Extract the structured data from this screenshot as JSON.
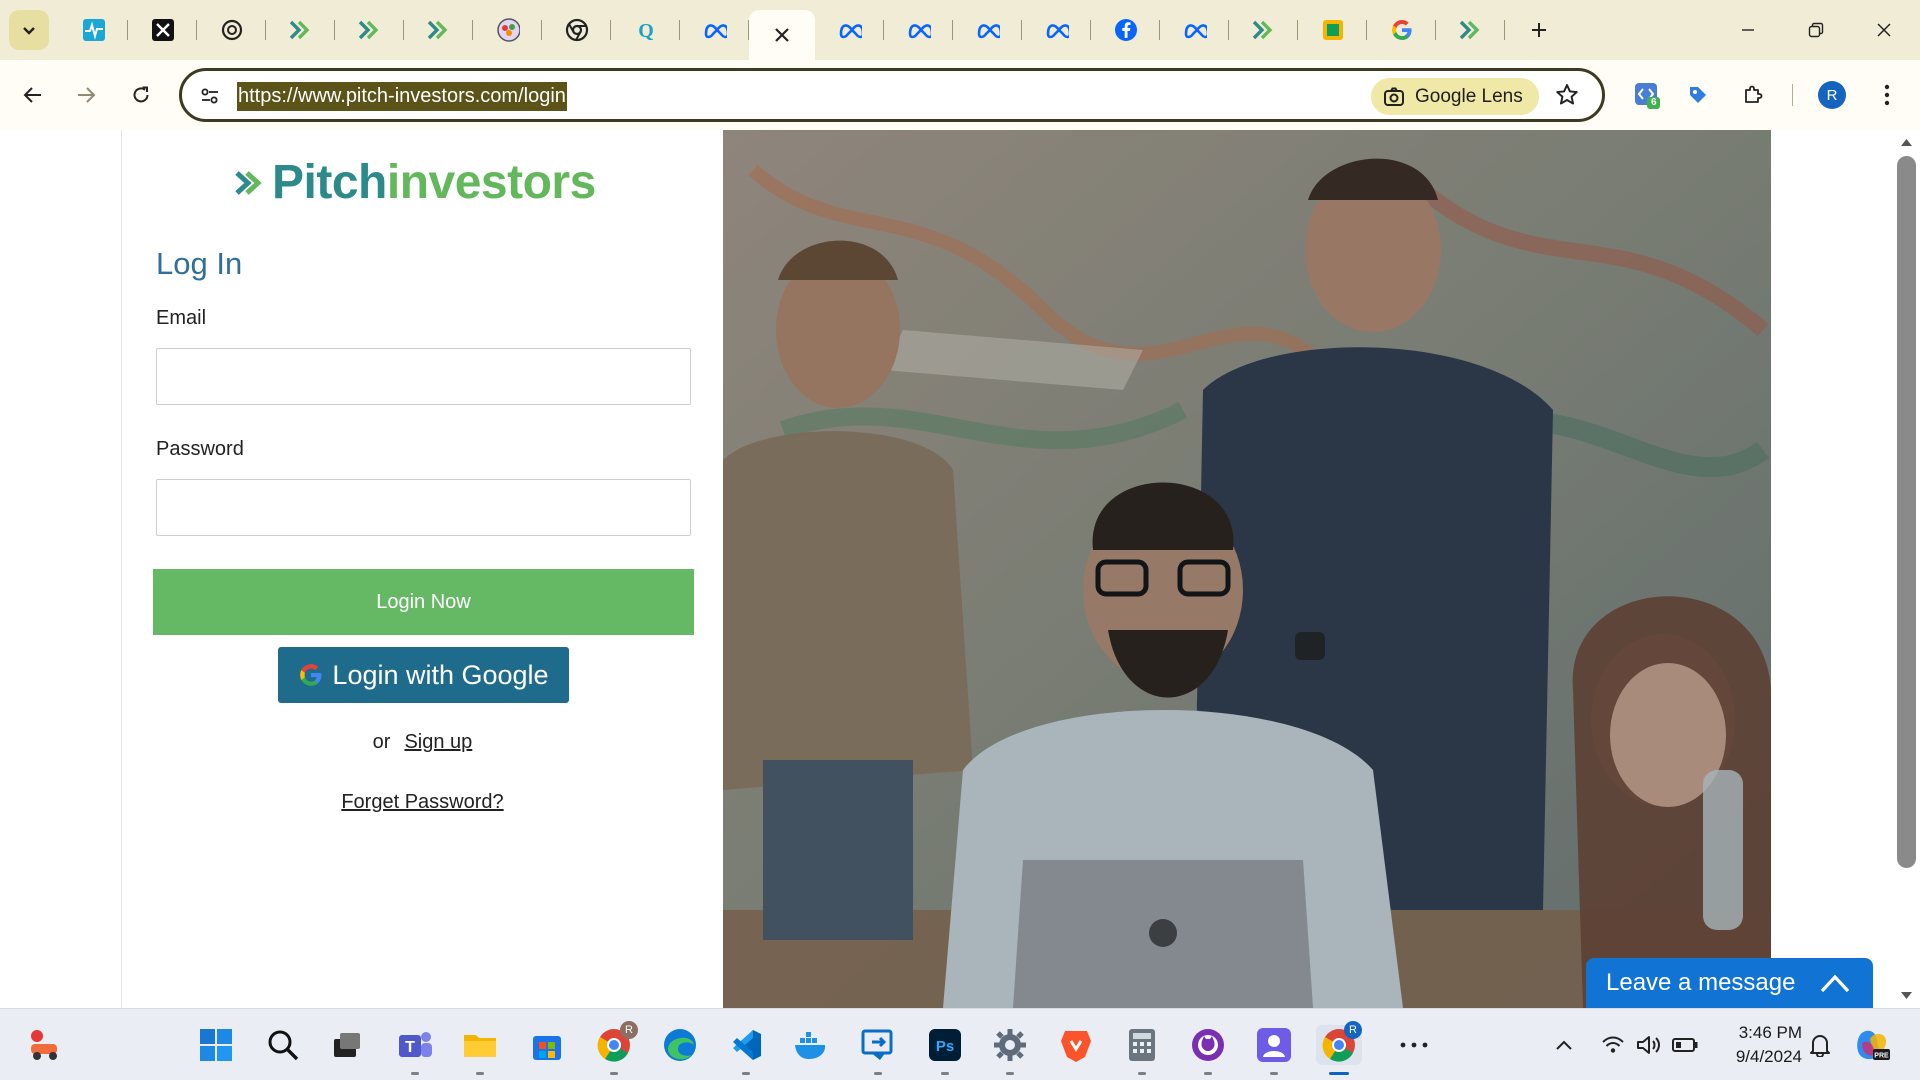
{
  "browser": {
    "url": "https://www.pitch-investors.com/login",
    "lens_label": "Google Lens",
    "profile_initial": "R",
    "extension_badge": "6",
    "tab_favicons": [
      "activity",
      "x",
      "openai",
      "pitch",
      "pitch",
      "pitch",
      "colorful",
      "chrome",
      "quora",
      "meta",
      "close",
      "meta",
      "meta",
      "meta",
      "meta",
      "facebook",
      "meta",
      "pitch",
      "pitch-green",
      "google",
      "pitch"
    ]
  },
  "page": {
    "logo_part1": "Pitch",
    "logo_part2": "investors",
    "title": "Log In",
    "email_label": "Email",
    "email_value": "",
    "password_label": "Password",
    "password_value": "",
    "login_button": "Login Now",
    "google_button": "Login with Google",
    "or_text": "or",
    "signup_link": "Sign up",
    "forgot_link": "Forget Password?",
    "chat_label": "Leave a message"
  },
  "taskbar": {
    "time": "3:46 PM",
    "date": "9/4/2024",
    "chrome_badge": "R"
  },
  "colors": {
    "tabstrip": "#f1ecd5",
    "accent_green": "#66b964",
    "google_button": "#1f6b8c",
    "chat": "#1173d4"
  }
}
